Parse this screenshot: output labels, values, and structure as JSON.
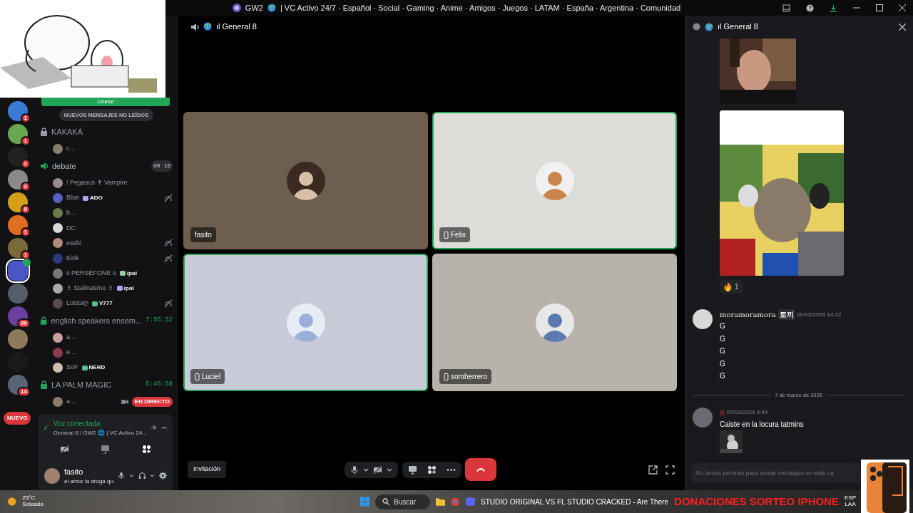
{
  "title_bar": {
    "server": "GW2",
    "topic": "| VC Activo 24/7 · Español · Social · Gaming · Anime · Amigos · Juegos · LATAM · España · Argentina · Comunidad"
  },
  "servers": [
    {
      "badge": "1",
      "selected": false,
      "color": "#3a7bd5"
    },
    {
      "badge": "1",
      "selected": false,
      "color": "#6aa84f"
    },
    {
      "badge": "2",
      "selected": false,
      "color": "#222222"
    },
    {
      "badge": "2",
      "selected": false,
      "color": "#8a8a8a"
    },
    {
      "badge": "9",
      "selected": false,
      "color": "#d4a017"
    },
    {
      "badge": "1",
      "selected": false,
      "color": "#e06c1f"
    },
    {
      "badge": "1",
      "selected": false,
      "color": "#7a6a3a"
    },
    {
      "selected": true,
      "color": "#4a55c8",
      "voice": true
    },
    {
      "selected": false,
      "color": "#555e68"
    },
    {
      "badge": "90",
      "selected": false,
      "color": "#6b3fa0"
    },
    {
      "selected": false,
      "color": "#8c7a5a"
    },
    {
      "selected": false,
      "color": "#1a1a1a"
    },
    {
      "badge": "14",
      "selected": false,
      "color": "#5a6478"
    }
  ],
  "new_server_pill": "NUEVO",
  "channel_list": {
    "join_button": "Unirse",
    "unread_pill": "NUEVOS MENSAJES NO LEÍDOS",
    "channels": [
      {
        "kind": "locked",
        "name": "KAKAKÁ",
        "members": [
          {
            "name": "c...",
            "muted": false
          }
        ]
      },
      {
        "kind": "voice",
        "name": "debate",
        "counts": [
          "09",
          "16"
        ],
        "members": [
          {
            "name": "! Pegasus ✝ Vampire",
            "muted": false
          },
          {
            "name": "Blue",
            "tag": "ADO",
            "muted": true
          },
          {
            "name": "b...",
            "muted": false
          },
          {
            "name": "DC",
            "muted": false
          },
          {
            "name": "esshi",
            "muted": true
          },
          {
            "name": "Kink",
            "muted": true
          },
          {
            "name": "ɞ PERSÉFONE ɞ",
            "tag": "/pol",
            "muted": false
          },
          {
            "name": "♗ Stalinasmo ♗",
            "tag": "/pol",
            "muted": false
          },
          {
            "name": "Loistaღ",
            "tag": "V777",
            "muted": true
          }
        ]
      },
      {
        "kind": "locked",
        "name": "english speakers ensem...",
        "timer": "7:55:32",
        "members": [
          {
            "name": "a...",
            "muted": false
          },
          {
            "name": "e...",
            "muted": false
          },
          {
            "name": "SoF",
            "tag": "NERD",
            "muted": false
          }
        ]
      },
      {
        "kind": "locked",
        "name": "LA PALM MAGIC",
        "timer": "5:46:58",
        "members": [
          {
            "name": "a...",
            "muted": false,
            "live": "EN DIRECTO"
          }
        ]
      }
    ]
  },
  "voice_panel": {
    "status": "Voz conectada",
    "location": "General 8 / GW2 🌐 | VC Activo 24..."
  },
  "user": {
    "name": "fasito",
    "status": "el amor la droga qu"
  },
  "stage": {
    "channel": "ıl General 8",
    "tiles": [
      {
        "name": "fasito",
        "speaking": false,
        "mobile": false,
        "color": "#6e5e4f"
      },
      {
        "name": "Felix",
        "speaking": true,
        "mobile": true,
        "color": "#dcdcd8"
      },
      {
        "name": "Luciel",
        "speaking": true,
        "mobile": true,
        "color": "#cacbd8"
      },
      {
        "name": "somherrero",
        "speaking": false,
        "mobile": true,
        "color": "#b7b3aa"
      }
    ]
  },
  "call_controls": {
    "invite": "Invitación"
  },
  "chat": {
    "channel": "ıl General 8",
    "reaction": {
      "count": "1"
    },
    "messages": [
      {
        "author": "moramoramora",
        "tag": "토끼",
        "time": "06/03/2026 14:22",
        "lines": [
          "G",
          "G",
          "G",
          "G",
          "G"
        ]
      },
      {
        "author": "S",
        "time": "07/03/2026 4:44",
        "lines": [
          "Caiste en la locura tatmins"
        ]
      }
    ],
    "divider": "7 de marzo de 2026",
    "placeholder": "No tienes permiso para enviar mensajes en este ca"
  },
  "taskbar": {
    "temperature": "25°C",
    "weather": "Soleado",
    "search": "Buscar",
    "window_title": "STUDIO ORIGINAL VS FL STUDIO CRACKED - Are There",
    "overlay_text": "DONACIONES SORTEO IPHONE",
    "language": "ESP",
    "layout": "LAA"
  }
}
